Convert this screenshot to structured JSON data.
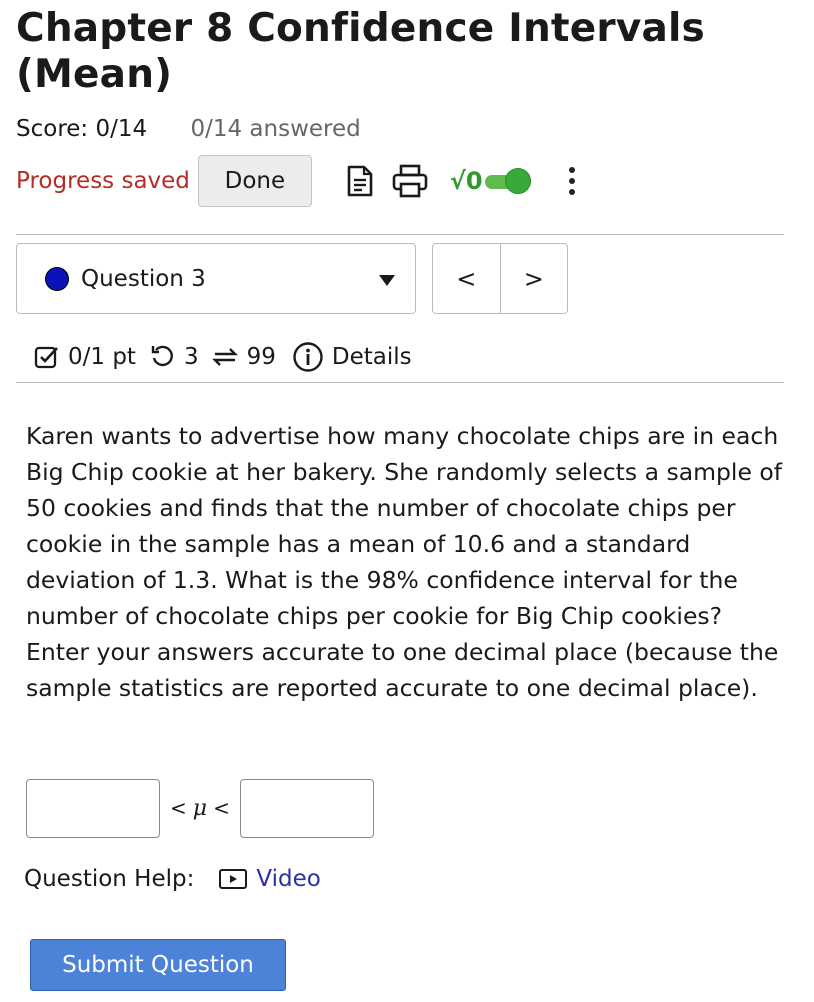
{
  "header": {
    "title": "Chapter 8 Confidence Intervals (Mean)",
    "score": "Score: 0/14",
    "answered": "0/14 answered"
  },
  "toolbar": {
    "progress_text": "Progress saved",
    "done_label": "Done",
    "sqrt_label": "√0",
    "icons": [
      "notes-icon",
      "print-icon",
      "math-toggle",
      "more-vertical-icon"
    ],
    "accent_color": "#3aa93a",
    "progress_color": "#b52b27"
  },
  "question_nav": {
    "selected": "Question 3",
    "dot_color": "#0b12b8",
    "prev_label": "<",
    "next_label": ">"
  },
  "meta": {
    "points": "0/1 pt",
    "attempts": "3",
    "retries": "99",
    "details_label": "Details"
  },
  "question": {
    "text": "Karen wants to advertise how many chocolate chips are in each Big Chip cookie at her bakery. She randomly selects a sample of 50 cookies and finds that the number of chocolate chips per cookie in the sample has a mean of 10.6 and a standard deviation of 1.3. What is the 98% confidence interval for the number of chocolate chips per cookie for Big Chip cookies? Enter your answers accurate to one decimal place (because the sample statistics are reported accurate to one decimal place).",
    "lower_value": "",
    "upper_value": "",
    "lt1": "<",
    "mu": "μ",
    "lt2": "<"
  },
  "help": {
    "label": "Question Help:",
    "video_label": "Video",
    "link_color": "#2f2fa6"
  },
  "submit": {
    "label": "Submit Question",
    "color": "#4c82d8"
  }
}
